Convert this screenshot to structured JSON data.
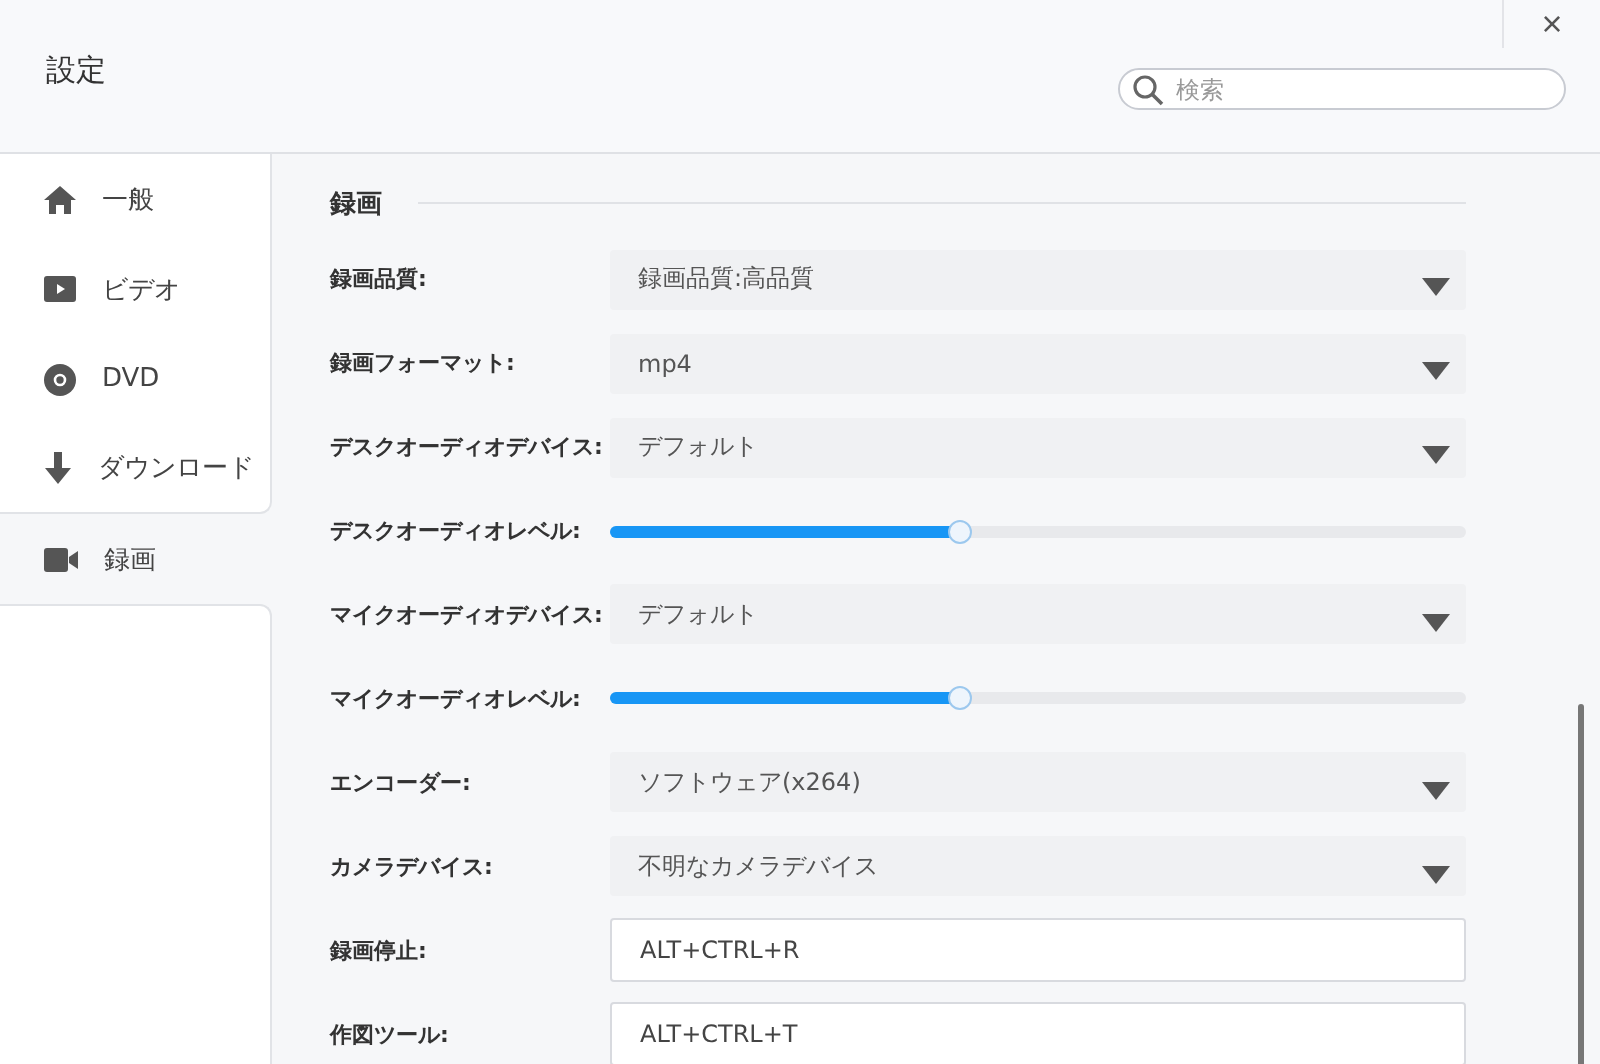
{
  "window": {
    "title": "設定",
    "close": "×"
  },
  "search": {
    "placeholder": "検索"
  },
  "sidebar": {
    "items": [
      {
        "label": "一般",
        "kind": "home",
        "selected": false
      },
      {
        "label": "ビデオ",
        "kind": "video",
        "selected": false
      },
      {
        "label": "DVD",
        "kind": "disc",
        "selected": false
      },
      {
        "label": "ダウンロード",
        "kind": "download",
        "selected": false
      },
      {
        "label": "録画",
        "kind": "camera",
        "selected": true
      }
    ]
  },
  "section": {
    "title": "録画"
  },
  "settings": [
    {
      "kind": "select",
      "label": "録画品質:",
      "value": "録画品質:高品質"
    },
    {
      "kind": "select",
      "label": "録画フォーマット:",
      "value": "mp4"
    },
    {
      "kind": "select",
      "label": "デスクオーディオデバイス:",
      "value": "デフォルト"
    },
    {
      "kind": "slider",
      "label": "デスクオーディオレベル:",
      "level": 0.41
    },
    {
      "kind": "select",
      "label": "マイクオーディオデバイス:",
      "value": "デフォルト"
    },
    {
      "kind": "slider",
      "label": "マイクオーディオレベル:",
      "level": 0.41
    },
    {
      "kind": "select",
      "label": "エンコーダー:",
      "value": "ソフトウェア(x264)"
    },
    {
      "kind": "select",
      "label": "カメラデバイス:",
      "value": "不明なカメラデバイス"
    },
    {
      "kind": "input",
      "label": "録画停止:",
      "value": "ALT+CTRL+R"
    },
    {
      "kind": "input",
      "label": "作図ツール:",
      "value": "ALT+CTRL+T"
    }
  ]
}
